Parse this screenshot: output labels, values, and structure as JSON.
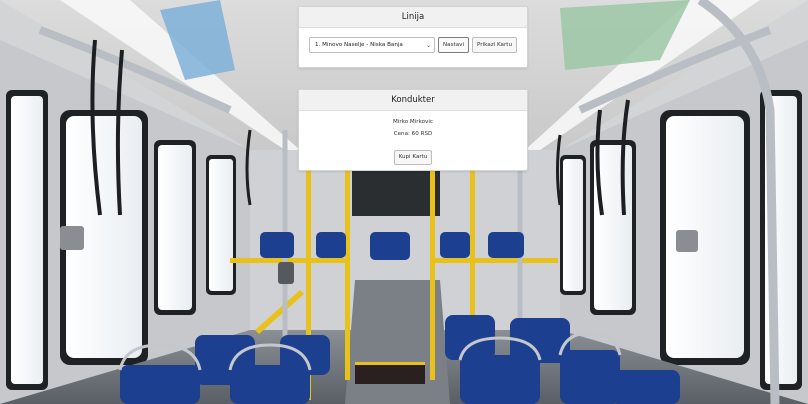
{
  "linija": {
    "title": "Linija",
    "selected_route": "1. Minovo Naselje - Niska Banja",
    "next_button": "Nastavi",
    "show_card_button": "Prikazi Kartu"
  },
  "kondukter": {
    "title": "Kondukter",
    "name": "Mirko Mirkovic",
    "price": "Cena: 60 RSD",
    "buy_button": "Kupi Kartu"
  },
  "colors": {
    "seat_blue": "#1d3f8f",
    "pole_yellow": "#e8c21a",
    "pole_silver": "#b9bec4",
    "card_header_bg": "#f1f1f1"
  }
}
